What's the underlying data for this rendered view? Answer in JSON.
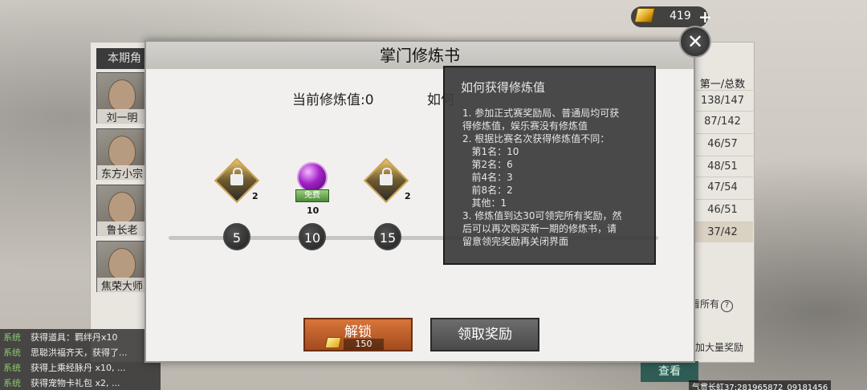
{
  "topbar": {
    "gold_value": "419",
    "plus_icon": "+",
    "close_icon": "✕"
  },
  "background": {
    "left_header": "本期角",
    "characters": [
      "刘一明",
      "东方小宗",
      "鲁长老",
      "焦荣大师"
    ],
    "rank_header": "第一/总数",
    "ranks": [
      "138/147",
      "87/142",
      "46/57",
      "48/51",
      "47/54",
      "46/51",
      "37/42"
    ],
    "see_all": "看所有",
    "promo_text": "加大量奖励",
    "view_button": "查看",
    "footer_id": "气贯长虹37:281965872_09181456"
  },
  "chat_log": [
    {
      "tag": "系统",
      "text": "获得道具：羁绊丹x10"
    },
    {
      "tag": "系统",
      "text": "思聪洪福齐天，获得了..."
    },
    {
      "tag": "系统",
      "text": "获得上乘经脉丹 x10, ..."
    },
    {
      "tag": "系统",
      "text": "获得宠物卡礼包 x2, ..."
    }
  ],
  "modal": {
    "title": "掌门修炼书",
    "current_label": "当前修炼值:0",
    "how_label": "如何",
    "milestones": [
      {
        "value": "5",
        "count": "2"
      },
      {
        "value": "10",
        "count": "10",
        "badge": "免费"
      },
      {
        "value": "15",
        "count": "2"
      }
    ],
    "unlock_button": "解锁",
    "unlock_price": "150",
    "claim_button": "领取奖励"
  },
  "tooltip": {
    "title": "如何获得修炼值",
    "body": "1. 参加正式赛奖励局、普通局均可获\n得修炼值，娱乐赛没有修炼值\n2. 根据比赛名次获得修炼值不同：\n   第1名：10\n   第2名：6\n   前4名：3\n   前8名：2\n   其他：1\n3. 修炼值到达30可领完所有奖励，然\n后可以再次购买新一期的修炼书，请\n留意领完奖励再关闭界面"
  }
}
